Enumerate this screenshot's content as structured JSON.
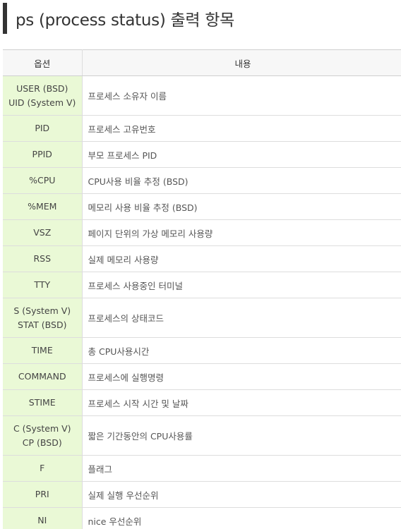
{
  "heading": {
    "title": "ps (process status) 출력 항목"
  },
  "table": {
    "headers": {
      "option": "옵션",
      "content": "내용"
    },
    "rows": [
      {
        "option": [
          "USER (BSD)",
          "UID (System V)"
        ],
        "content": "프로세스 소유자 이름"
      },
      {
        "option": [
          "PID"
        ],
        "content": "프로세스 고유번호"
      },
      {
        "option": [
          "PPID"
        ],
        "content": "부모 프로세스 PID"
      },
      {
        "option": [
          "%CPU"
        ],
        "content": "CPU사용 비율 추정 (BSD)"
      },
      {
        "option": [
          "%MEM"
        ],
        "content": "메모리 사용 비율 추정 (BSD)"
      },
      {
        "option": [
          "VSZ"
        ],
        "content": "페이지 단위의 가상 메모리 사용량"
      },
      {
        "option": [
          "RSS"
        ],
        "content": "실제 메모리 사용량"
      },
      {
        "option": [
          "TTY"
        ],
        "content": "프로세스 사용중인 터미널"
      },
      {
        "option": [
          "S (System V)",
          "STAT (BSD)"
        ],
        "content": "프로세스의 상태코드"
      },
      {
        "option": [
          "TIME"
        ],
        "content": "총 CPU사용시간"
      },
      {
        "option": [
          "COMMAND"
        ],
        "content": "프로세스에 실행명령"
      },
      {
        "option": [
          "STIME"
        ],
        "content": "프로세스 시작 시간 및 날짜"
      },
      {
        "option": [
          "C (System V)",
          "CP (BSD)"
        ],
        "content": "짧은 기간동안의 CPU사용률"
      },
      {
        "option": [
          "F"
        ],
        "content": "플래그"
      },
      {
        "option": [
          "PRI"
        ],
        "content": "실제 실행 우선순위"
      },
      {
        "option": [
          "NI"
        ],
        "content": "nice 우선순위"
      }
    ]
  },
  "colors": {
    "option_cell_bg": "#eaf9d6",
    "header_bg": "#f7f7f7",
    "heading_bar": "#333333"
  }
}
